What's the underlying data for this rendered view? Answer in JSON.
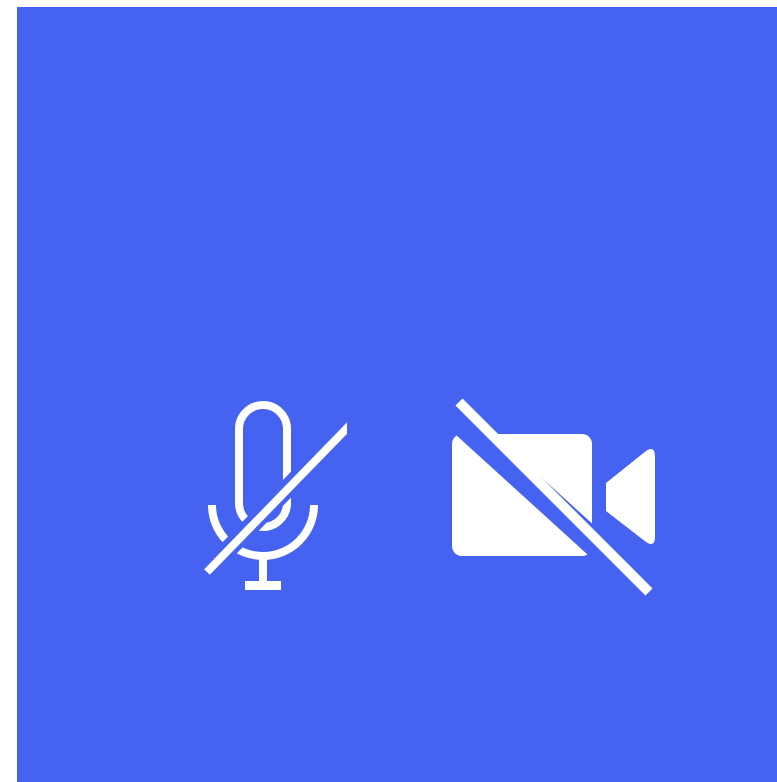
{
  "call": {
    "background_color": "#4562f0",
    "icon_color": "#ffffff"
  },
  "controls": {
    "microphone": {
      "icon": "mic-off-icon",
      "state": "muted"
    },
    "camera": {
      "icon": "video-off-icon",
      "state": "off"
    }
  }
}
